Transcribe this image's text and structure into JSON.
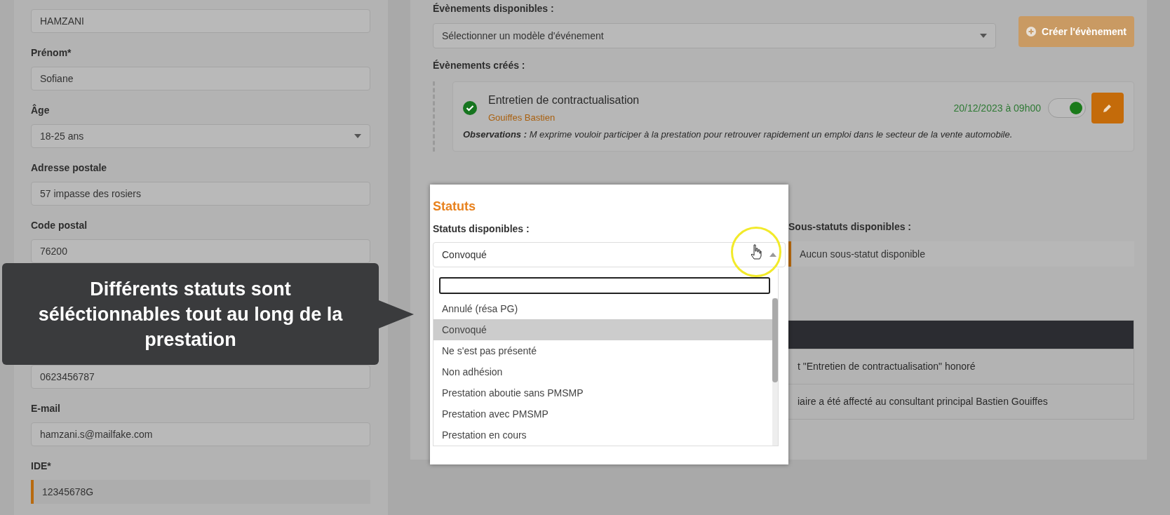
{
  "identity_form": {
    "fields": [
      {
        "value": "HAMZANI",
        "kind": "text"
      },
      {
        "label": "Prénom*",
        "value": "Sofiane",
        "kind": "text"
      },
      {
        "label": "Âge",
        "value": "18-25 ans",
        "kind": "select"
      },
      {
        "label": "Adresse postale",
        "value": "57 impasse des rosiers",
        "kind": "text"
      },
      {
        "label": "Code postal",
        "value": "76200",
        "kind": "text"
      },
      {
        "value": "0623456787",
        "kind": "text"
      },
      {
        "label": "E-mail",
        "value": "hamzani.s@mailfake.com",
        "kind": "text"
      },
      {
        "label": "IDE*",
        "value": "12345678G",
        "kind": "flagged"
      }
    ]
  },
  "events": {
    "available_label": "Évènements disponibles :",
    "template_select": {
      "placeholder": "Sélectionner un modèle d'événement"
    },
    "create_button": "Créer l'évènement",
    "created_label": "Évènements créés :",
    "created": [
      {
        "title": "Entretien de contractualisation",
        "consultant": "Gouiffes Bastien",
        "date": "20/12/2023 à 09h00",
        "done": true,
        "on": true,
        "observations_label": "Observations :",
        "observations": "M exprime vouloir participer à la prestation pour retrouver rapidement un emploi dans le secteur de la vente automobile."
      }
    ]
  },
  "statuses": {
    "title": "Statuts",
    "available_label": "Statuts disponibles :",
    "value": "Convoqué",
    "options": [
      {
        "label": "Annulé (résa PG)",
        "selected": false
      },
      {
        "label": "Convoqué",
        "selected": true
      },
      {
        "label": "Ne s'est pas présenté",
        "selected": false
      },
      {
        "label": "Non adhésion",
        "selected": false
      },
      {
        "label": "Prestation aboutie sans PMSMP",
        "selected": false
      },
      {
        "label": "Prestation avec PMSMP",
        "selected": false
      },
      {
        "label": "Prestation en cours",
        "selected": false
      }
    ]
  },
  "sub_statuses": {
    "label": "Sous-statuts disponibles :",
    "value": "Aucun sous-statut disponible"
  },
  "history": {
    "rows": [
      "t \"Entretien de contractualisation\" honoré",
      "iaire a été affecté au consultant principal Bastien Gouiffes"
    ]
  },
  "tooltip": {
    "text": "Différents statuts sont séléctionnables tout au long de la prestation"
  }
}
